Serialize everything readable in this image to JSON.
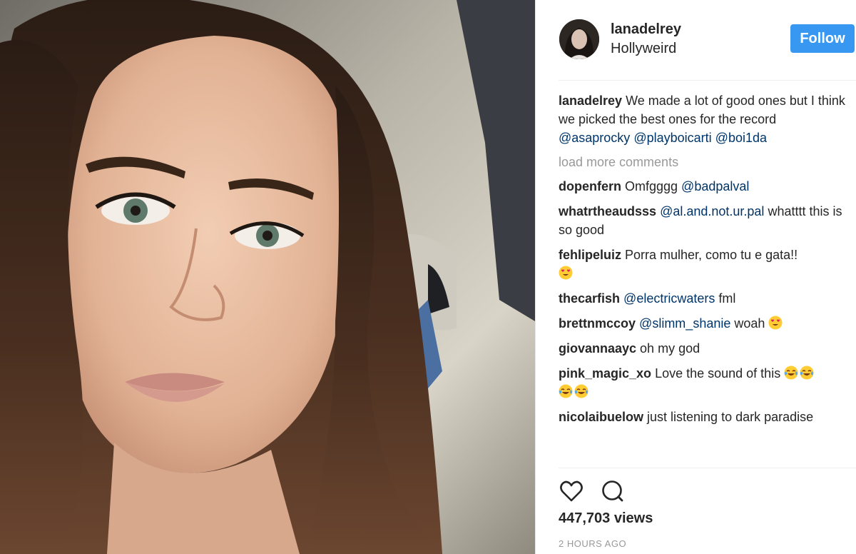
{
  "post": {
    "username": "lanadelrey",
    "location": "Hollyweird",
    "follow_label": "Follow",
    "avatar_icon": "profile-photo",
    "photo_icon": "selfie-photo",
    "accent_color": "#3897f0"
  },
  "caption": {
    "username": "lanadelrey",
    "text": " We made a lot of good ones but I think we picked the best ones for the record",
    "mentions": [
      "@asaprocky",
      "@playboicarti",
      "@boi1da"
    ]
  },
  "load_more": "load more comments",
  "comments": [
    {
      "user": "dopenfern",
      "text": " Omfgggg ",
      "mention": "@badpalval"
    },
    {
      "user": "whatrtheaudsss",
      "mention": "@al.and.not.ur.pal",
      "text": " whatttt this is so good"
    },
    {
      "user": "fehlipeluiz",
      "text": " Porra mulher, como tu e gata!!",
      "emoji": "heart-eyes"
    },
    {
      "user": "thecarfish",
      "mention": "@electricwaters",
      "text": " fml"
    },
    {
      "user": "brettnmccoy",
      "mention": "@slimm_shanie",
      "text": " woah",
      "emoji": "heart-eyes"
    },
    {
      "user": "giovannaayc",
      "text": " oh my god"
    },
    {
      "user": "pink_magic_xo",
      "text": " Love the sound of this",
      "emoji": "tears-of-joy"
    },
    {
      "user": "nicolaibuelow",
      "text": " just listening to dark paradise"
    }
  ],
  "actions": {
    "like_icon": "heart-icon",
    "comment_icon": "comment-bubble-icon"
  },
  "views": "447,703 views",
  "timestamp": "2 HOURS AGO"
}
